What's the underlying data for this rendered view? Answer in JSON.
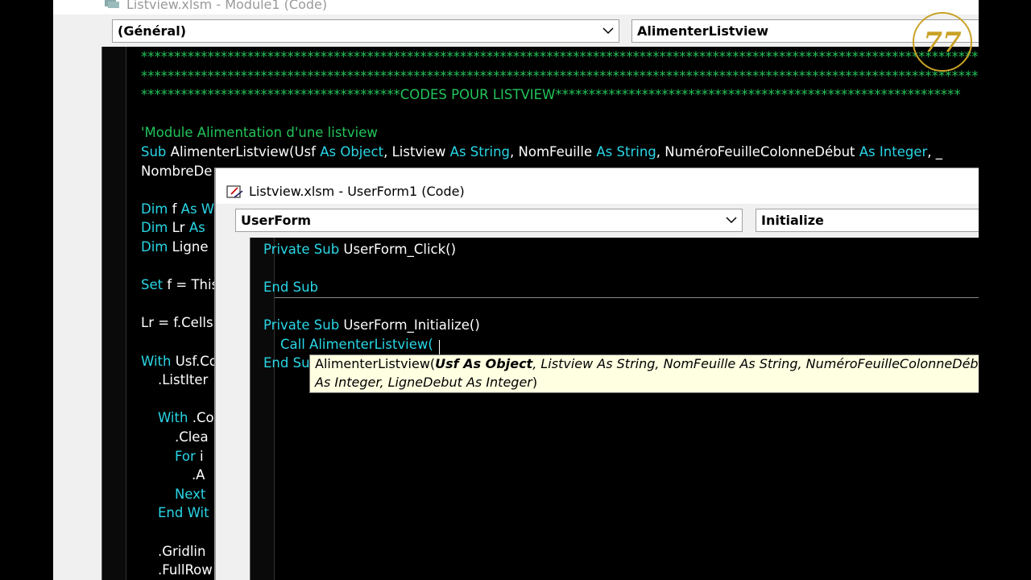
{
  "module_window": {
    "title": "Listview.xlsm - Module1 (Code)",
    "object_combo": "(Général)",
    "procedure_combo": "AlimenterListview",
    "lines": [
      {
        "parts": [
          {
            "t": "cm",
            "v": "**********************************************************************************************************************************"
          }
        ]
      },
      {
        "parts": [
          {
            "t": "cm",
            "v": "**********************************************************************************************************************************"
          }
        ]
      },
      {
        "parts": [
          {
            "t": "cm",
            "v": "***************************************CODES POUR LISTVIEW*************************************************************"
          }
        ]
      },
      {
        "parts": []
      },
      {
        "parts": [
          {
            "t": "cm",
            "v": "'Module Alimentation d'une listview"
          }
        ]
      },
      {
        "parts": [
          {
            "t": "kw",
            "v": "Sub "
          },
          {
            "t": "tx",
            "v": "AlimenterListview(Usf "
          },
          {
            "t": "kw",
            "v": "As Object"
          },
          {
            "t": "tx",
            "v": ", Listview "
          },
          {
            "t": "kw",
            "v": "As String"
          },
          {
            "t": "tx",
            "v": ", NomFeuille "
          },
          {
            "t": "kw",
            "v": "As String"
          },
          {
            "t": "tx",
            "v": ", NuméroFeuilleColonneDébut "
          },
          {
            "t": "kw",
            "v": "As Integer"
          },
          {
            "t": "tx",
            "v": ", _"
          }
        ]
      },
      {
        "parts": [
          {
            "t": "tx",
            "v": "NombreDe"
          }
        ]
      },
      {
        "parts": []
      },
      {
        "parts": [
          {
            "t": "kw",
            "v": "Dim "
          },
          {
            "t": "tx",
            "v": "f "
          },
          {
            "t": "kw",
            "v": "As W"
          }
        ]
      },
      {
        "parts": [
          {
            "t": "kw",
            "v": "Dim "
          },
          {
            "t": "tx",
            "v": "Lr "
          },
          {
            "t": "kw",
            "v": "As"
          }
        ]
      },
      {
        "parts": [
          {
            "t": "kw",
            "v": "Dim "
          },
          {
            "t": "tx",
            "v": "Ligne"
          }
        ]
      },
      {
        "parts": []
      },
      {
        "parts": [
          {
            "t": "kw",
            "v": "Set "
          },
          {
            "t": "tx",
            "v": "f = This"
          }
        ]
      },
      {
        "parts": []
      },
      {
        "parts": [
          {
            "t": "tx",
            "v": "Lr = f.Cells"
          }
        ]
      },
      {
        "parts": []
      },
      {
        "parts": [
          {
            "t": "kw",
            "v": "With "
          },
          {
            "t": "tx",
            "v": "Usf.Co"
          }
        ]
      },
      {
        "parts": [
          {
            "t": "tx",
            "v": "    .ListIter"
          }
        ]
      },
      {
        "parts": []
      },
      {
        "parts": [
          {
            "t": "kw",
            "v": "    With "
          },
          {
            "t": "tx",
            "v": ".Co"
          }
        ]
      },
      {
        "parts": [
          {
            "t": "tx",
            "v": "        .Clea"
          }
        ]
      },
      {
        "parts": [
          {
            "t": "kw",
            "v": "        For "
          },
          {
            "t": "tx",
            "v": "i"
          }
        ]
      },
      {
        "parts": [
          {
            "t": "tx",
            "v": "            .A"
          }
        ]
      },
      {
        "parts": [
          {
            "t": "kw",
            "v": "        Next"
          }
        ]
      },
      {
        "parts": [
          {
            "t": "kw",
            "v": "    End Wit"
          }
        ]
      },
      {
        "parts": []
      },
      {
        "parts": [
          {
            "t": "tx",
            "v": "    .Gridlin"
          }
        ]
      },
      {
        "parts": [
          {
            "t": "tx",
            "v": "    .FullRow"
          }
        ]
      }
    ]
  },
  "userform_window": {
    "title": "Listview.xlsm - UserForm1 (Code)",
    "object_combo": "UserForm",
    "procedure_combo": "Initialize",
    "lines": [
      {
        "parts": [
          {
            "t": "kw",
            "v": "Private Sub "
          },
          {
            "t": "tx",
            "v": "UserForm_Click()"
          }
        ]
      },
      {
        "parts": []
      },
      {
        "parts": [
          {
            "t": "kw",
            "v": "End Sub"
          }
        ]
      },
      {
        "parts": []
      },
      {
        "parts": [
          {
            "t": "kw",
            "v": "Private Sub "
          },
          {
            "t": "tx",
            "v": "UserForm_Initialize()"
          }
        ]
      },
      {
        "parts": [
          {
            "t": "kw",
            "v": "    Call "
          },
          {
            "t": "kw",
            "v": "AlimenterListview("
          }
        ]
      },
      {
        "parts": [
          {
            "t": "kw",
            "v": "End Su"
          }
        ]
      }
    ],
    "tooltip": {
      "line1_prefix": "AlimenterListview(",
      "line1_bold": "Usf As Object",
      "line1_rest": ", Listview As String, NomFeuille As String, NuméroFeuilleColonneDéb",
      "line2_italic": "As Integer, LigneDebut As Integer",
      "line2_close": ")"
    }
  },
  "colors": {
    "keyword": "#2ad6e6",
    "text": "#ffffff",
    "comment": "#22c45a",
    "tooltip_bg": "#ffffe1"
  },
  "logo": {
    "text": "77",
    "icon": "77-logo-icon"
  }
}
